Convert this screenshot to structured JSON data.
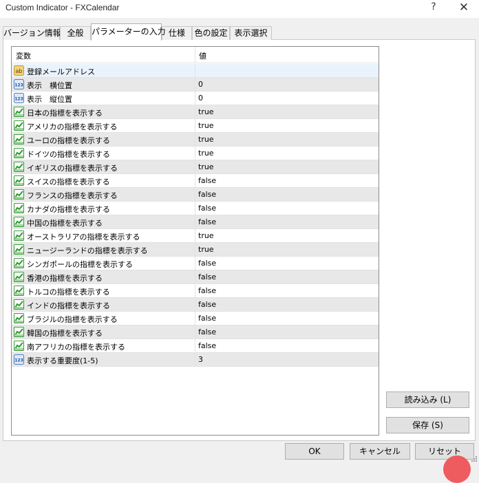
{
  "window": {
    "title": "Custom Indicator - FXCalendar",
    "help_glyph": "?",
    "close_glyph": "✕"
  },
  "tabs": [
    {
      "label": "バージョン情報"
    },
    {
      "label": "全般"
    },
    {
      "label": "パラメーターの入力",
      "active": true
    },
    {
      "label": "仕様"
    },
    {
      "label": "色の設定"
    },
    {
      "label": "表示選択"
    }
  ],
  "grid": {
    "headers": {
      "variable": "変数",
      "value": "値"
    },
    "rows": [
      {
        "icon": "string-ab-icon",
        "label": "登録メールアドレス",
        "value": ""
      },
      {
        "icon": "integer-123-icon",
        "label": "表示　横位置",
        "value": "0"
      },
      {
        "icon": "integer-123-icon",
        "label": "表示　縦位置",
        "value": "0"
      },
      {
        "icon": "boolean-chart-icon",
        "label": "日本の指標を表示する",
        "value": "true"
      },
      {
        "icon": "boolean-chart-icon",
        "label": "アメリカの指標を表示する",
        "value": "true"
      },
      {
        "icon": "boolean-chart-icon",
        "label": "ユーロの指標を表示する",
        "value": "true"
      },
      {
        "icon": "boolean-chart-icon",
        "label": "ドイツの指標を表示する",
        "value": "true"
      },
      {
        "icon": "boolean-chart-icon",
        "label": "イギリスの指標を表示する",
        "value": "true"
      },
      {
        "icon": "boolean-chart-icon",
        "label": "スイスの指標を表示する",
        "value": "false"
      },
      {
        "icon": "boolean-chart-icon",
        "label": "フランスの指標を表示する",
        "value": "false"
      },
      {
        "icon": "boolean-chart-icon",
        "label": "カナダの指標を表示する",
        "value": "false"
      },
      {
        "icon": "boolean-chart-icon",
        "label": "中国の指標を表示する",
        "value": "false"
      },
      {
        "icon": "boolean-chart-icon",
        "label": "オーストラリアの指標を表示する",
        "value": "true"
      },
      {
        "icon": "boolean-chart-icon",
        "label": "ニュージーランドの指標を表示する",
        "value": "true"
      },
      {
        "icon": "boolean-chart-icon",
        "label": "シンガポールの指標を表示する",
        "value": "false"
      },
      {
        "icon": "boolean-chart-icon",
        "label": "香港の指標を表示する",
        "value": "false"
      },
      {
        "icon": "boolean-chart-icon",
        "label": "トルコの指標を表示する",
        "value": "false"
      },
      {
        "icon": "boolean-chart-icon",
        "label": "インドの指標を表示する",
        "value": "false"
      },
      {
        "icon": "boolean-chart-icon",
        "label": "ブラジルの指標を表示する",
        "value": "false"
      },
      {
        "icon": "boolean-chart-icon",
        "label": "韓国の指標を表示する",
        "value": "false"
      },
      {
        "icon": "boolean-chart-icon",
        "label": "南アフリカの指標を表示する",
        "value": "false"
      },
      {
        "icon": "integer-123-icon",
        "label": "表示する重要度(1-5)",
        "value": "3"
      }
    ]
  },
  "side_buttons": {
    "load": "読み込み (L)",
    "save": "保存 (S)"
  },
  "footer_buttons": {
    "ok": "OK",
    "cancel": "キャンセル",
    "reset": "リセット"
  }
}
